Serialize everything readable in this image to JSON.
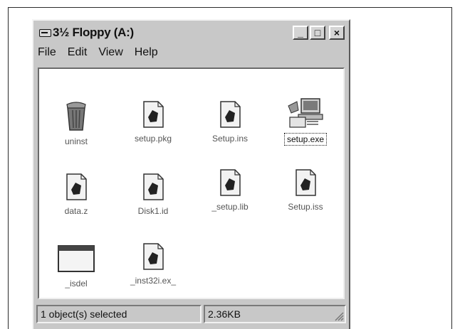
{
  "window": {
    "title": "3½ Floppy (A:)",
    "buttons": {
      "minimize": "_",
      "maximize": "□",
      "close": "×"
    }
  },
  "menu": [
    "File",
    "Edit",
    "View",
    "Help"
  ],
  "files": [
    {
      "name": "uninst",
      "icon": "recycle-bin-icon"
    },
    {
      "name": "setup.pkg",
      "icon": "document-icon"
    },
    {
      "name": "Setup.ins",
      "icon": "document-icon"
    },
    {
      "name": "setup.exe",
      "icon": "setup-program-icon",
      "selected": true
    },
    {
      "name": "data.z",
      "icon": "document-icon"
    },
    {
      "name": "Disk1.id",
      "icon": "document-icon"
    },
    {
      "name": "_setup.lib",
      "icon": "document-icon"
    },
    {
      "name": "Setup.iss",
      "icon": "document-icon"
    },
    {
      "name": "_isdel",
      "icon": "window-icon"
    },
    {
      "name": "_inst32i.ex_",
      "icon": "document-icon"
    }
  ],
  "status": {
    "selection": "1 object(s) selected",
    "size": "2.36KB"
  }
}
